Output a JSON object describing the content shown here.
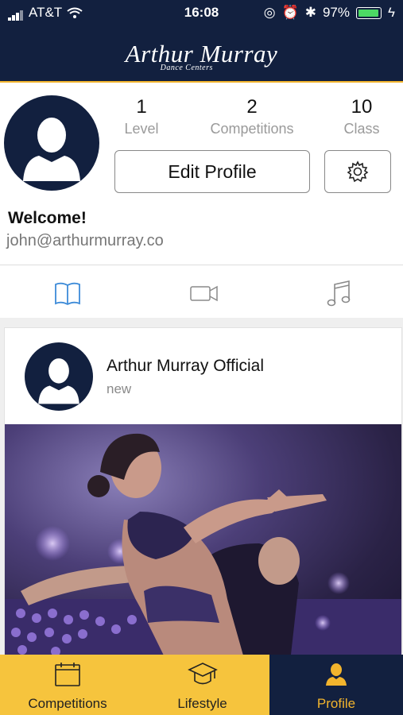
{
  "status_bar": {
    "carrier": "AT&T",
    "time": "16:08",
    "battery": "97%",
    "battery_level": 0.97
  },
  "header": {
    "logo_text": "Arthur Murray",
    "logo_sub": "Dance Centers"
  },
  "profile": {
    "stats": [
      {
        "value": "1",
        "label": "Level"
      },
      {
        "value": "2",
        "label": "Competitions"
      },
      {
        "value": "10",
        "label": "Class"
      }
    ],
    "edit_button": "Edit Profile",
    "welcome": "Welcome!",
    "email": "john@arthurmurray.co"
  },
  "content_tabs": [
    "book-icon",
    "video-icon",
    "music-icon"
  ],
  "post": {
    "author": "Arthur Murray Official",
    "time": "new"
  },
  "tabbar": {
    "items": [
      {
        "label": "Competitions",
        "icon": "calendar-icon"
      },
      {
        "label": "Lifestyle",
        "icon": "graduation-cap-icon"
      },
      {
        "label": "Profile",
        "icon": "person-icon"
      }
    ]
  },
  "colors": {
    "navy": "#12203f",
    "accent": "#f2b42d",
    "link_blue": "#3d8bd8"
  }
}
